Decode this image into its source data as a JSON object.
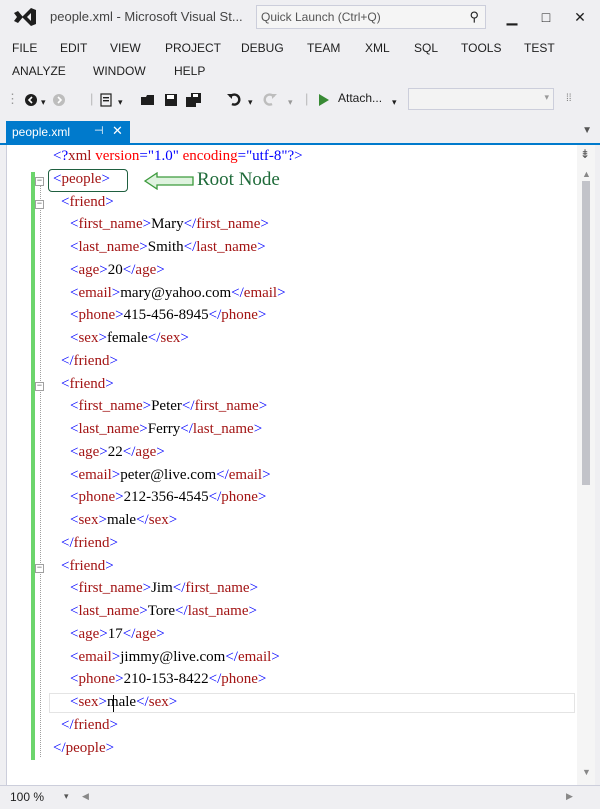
{
  "window": {
    "title": "people.xml - Microsoft Visual St...",
    "quick_launch_placeholder": "Quick Launch (Ctrl+Q)",
    "minimize": "▁",
    "maximize": "□",
    "close": "✕"
  },
  "menu": {
    "row1": [
      "FILE",
      "EDIT",
      "VIEW",
      "PROJECT",
      "DEBUG",
      "TEAM",
      "XML",
      "SQL",
      "TOOLS",
      "TEST"
    ],
    "row2": [
      "ANALYZE",
      "WINDOW",
      "HELP"
    ]
  },
  "toolbar": {
    "attach_label": "Attach...",
    "config_value": ""
  },
  "tab": {
    "label": "people.xml",
    "pin": "⊣",
    "close": "✕"
  },
  "editor": {
    "annotation_label": "Root Node",
    "xml_decl": {
      "open": "<?",
      "name": "xml",
      "attr1": "version",
      "val1": "\"1.0\"",
      "attr2": "encoding",
      "val2": "\"utf-8\"",
      "close": "?>"
    },
    "root_tag": "people",
    "item_tag": "friend",
    "fields": [
      "first_name",
      "last_name",
      "age",
      "email",
      "phone",
      "sex"
    ],
    "friends": [
      {
        "first_name": "Mary",
        "last_name": "Smith",
        "age": "20",
        "email": "mary@yahoo.com",
        "phone": "415-456-8945",
        "sex": "female"
      },
      {
        "first_name": "Peter",
        "last_name": "Ferry",
        "age": "22",
        "email": "peter@live.com",
        "phone": "212-356-4545",
        "sex": "male"
      },
      {
        "first_name": "Jim",
        "last_name": "Tore",
        "age": "17",
        "email": "jimmy@live.com",
        "phone": "210-153-8422",
        "sex": "male"
      }
    ]
  },
  "status": {
    "zoom": "100 %"
  },
  "colors": {
    "accent": "#007ACC",
    "bracket": "#0000FF",
    "tag": "#A31515",
    "attribute": "#FF0000",
    "change_bar": "#6CD56C",
    "annotation": "#1F6B3A"
  }
}
